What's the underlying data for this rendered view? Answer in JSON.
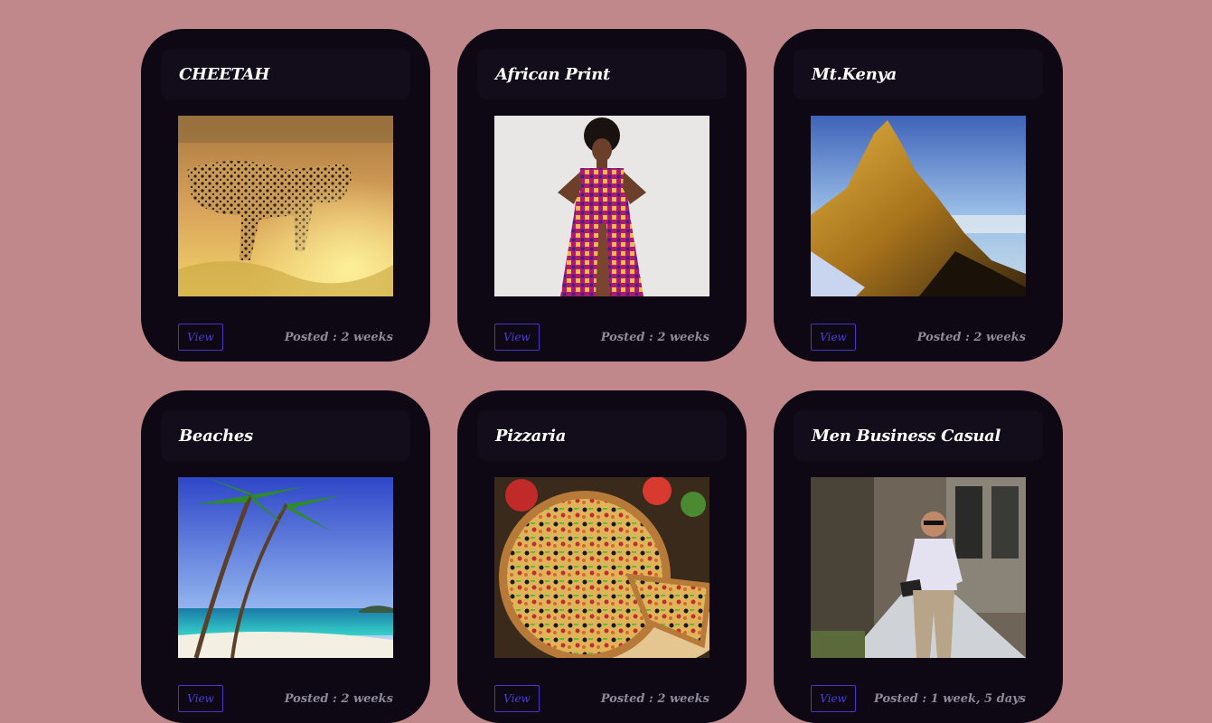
{
  "cards": [
    {
      "title": "CHEETAH",
      "view_label": "View",
      "posted": "Posted : 2 weeks",
      "image": "cheetah-photo"
    },
    {
      "title": "African Print",
      "view_label": "View",
      "posted": "Posted : 2 weeks",
      "image": "african-print-dress-photo"
    },
    {
      "title": "Mt.Kenya",
      "view_label": "View",
      "posted": "Posted : 2 weeks",
      "image": "mount-kenya-photo"
    },
    {
      "title": "Beaches",
      "view_label": "View",
      "posted": "Posted : 2 weeks",
      "image": "beach-palm-photo"
    },
    {
      "title": "Pizzaria",
      "view_label": "View",
      "posted": "Posted : 2 weeks",
      "image": "pizza-photo"
    },
    {
      "title": "Men Business Casual",
      "view_label": "View",
      "posted": "Posted : 1 week, 5 days",
      "image": "business-casual-man-photo"
    }
  ],
  "colors": {
    "page_background": "#c0888a",
    "card_background": "#0d0814",
    "button_accent": "#4a35c7",
    "posted_text": "#8e8a98"
  }
}
